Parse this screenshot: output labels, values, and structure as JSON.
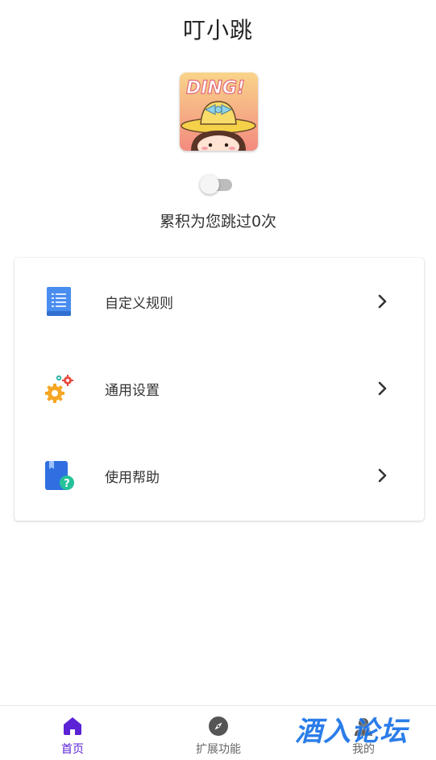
{
  "header": {
    "title": "叮小跳"
  },
  "logo": {
    "text": "DING!"
  },
  "toggle": {
    "state": "off"
  },
  "stats": {
    "skip_text": "累积为您跳过0次"
  },
  "menu": {
    "items": [
      {
        "label": "自定义规则",
        "icon": "document-list-icon"
      },
      {
        "label": "通用设置",
        "icon": "gears-icon"
      },
      {
        "label": "使用帮助",
        "icon": "help-book-icon"
      }
    ]
  },
  "bottom_nav": {
    "items": [
      {
        "label": "首页",
        "icon": "home-icon",
        "active": true
      },
      {
        "label": "扩展功能",
        "icon": "compass-icon",
        "active": false
      },
      {
        "label": "我的",
        "icon": "user-icon",
        "active": false
      }
    ]
  },
  "watermark": {
    "text": "酒入论坛"
  },
  "colors": {
    "accent": "#5b22d6",
    "icon_blue": "#4a8df0"
  }
}
